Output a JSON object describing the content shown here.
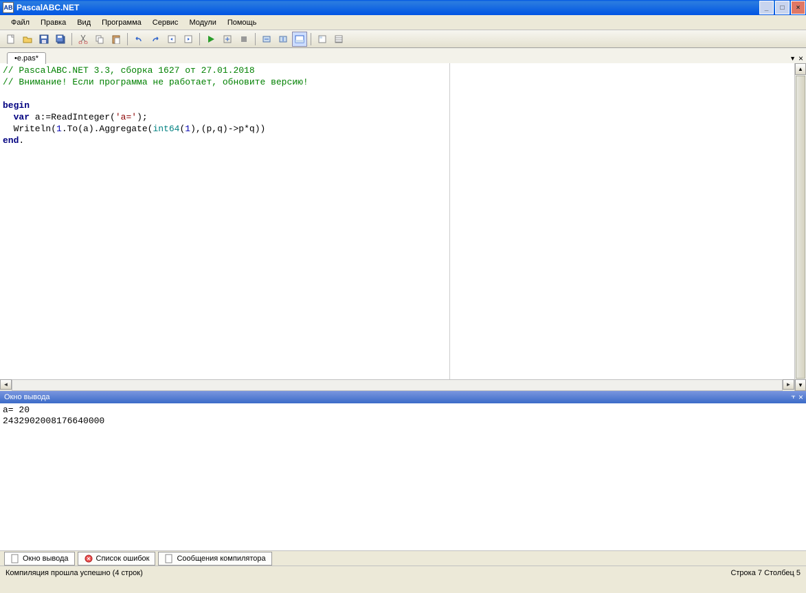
{
  "title": "PascalABC.NET",
  "menu": [
    "Файл",
    "Правка",
    "Вид",
    "Программа",
    "Сервис",
    "Модули",
    "Помощь"
  ],
  "tab": {
    "label": "•e.pas*"
  },
  "toolbar_icons": [
    "new-file-icon",
    "open-file-icon",
    "save-icon",
    "save-all-icon",
    "sep",
    "cut-icon",
    "copy-icon",
    "paste-icon",
    "sep",
    "undo-icon",
    "redo-icon",
    "nav-back-icon",
    "nav-forward-icon",
    "sep",
    "run-icon",
    "compile-icon",
    "stop-icon",
    "sep",
    "step-over-icon",
    "step-into-icon",
    "toggle-output-icon",
    "sep",
    "design-icon",
    "properties-icon"
  ],
  "code": {
    "l1_a": "// PascalABC.NET 3.3, сборка 1627 от 27.01.2018",
    "l2_a": "// Внимание! Если программа не работает, обновите версию!",
    "l3_a": "",
    "l4_a": "begin",
    "l5_a": "  ",
    "l5_b": "var",
    "l5_c": " a:=ReadInteger(",
    "l5_d": "'a='",
    "l5_e": ");",
    "l6_a": "  Writeln(",
    "l6_b": "1",
    "l6_c": ".To(a).Aggregate(",
    "l6_d": "int64",
    "l6_e": "(",
    "l6_f": "1",
    "l6_g": "),(p,q)->p*q))",
    "l7_a": "end",
    "l7_b": "."
  },
  "output_header": "Окно вывода",
  "output": "a= 20\n2432902008176640000",
  "bottom_tabs": {
    "t1": "Окно вывода",
    "t2": "Список ошибок",
    "t3": "Сообщения компилятора"
  },
  "status_left": "Компиляция прошла успешно (4 строк)",
  "status_right": "Строка  7 Столбец  5"
}
